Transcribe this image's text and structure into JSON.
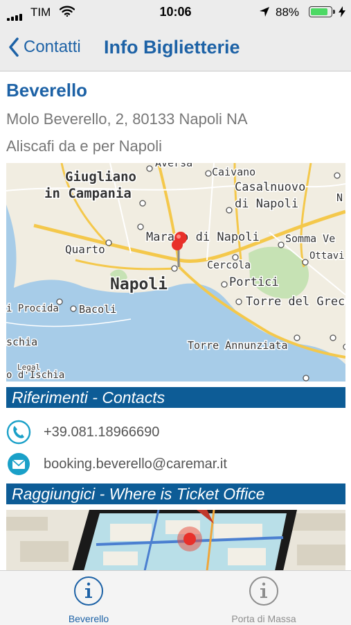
{
  "status_bar": {
    "carrier": "TIM",
    "time": "10:06",
    "battery_percent": "88%",
    "battery_level": 0.88,
    "icons": [
      "signal-bars-icon",
      "wifi-icon",
      "location-arrow-icon",
      "battery-icon",
      "charging-bolt-icon"
    ]
  },
  "nav": {
    "back_label": "Contatti",
    "title": "Info Biglietterie"
  },
  "office": {
    "name": "Beverello",
    "address": "Molo Beverello, 2, 80133 Napoli NA",
    "description": "Aliscafi da e per Napoli"
  },
  "map": {
    "legal": "Legal",
    "labels": {
      "aversa": "Aversa",
      "caivano": "Caivano",
      "giugliano": "Giugliano\nin Campania",
      "casalnuovo": "Casalnuovo\ndi Napoli",
      "n": "N",
      "marano": "Marano di Napoli",
      "somma": "Somma Ve",
      "quarto": "Quarto",
      "cercola": "Cercola",
      "ottavi": "Ottavi",
      "napoli": "Napoli",
      "portici": "Portici",
      "procida": "i Procida",
      "bacoli": "Bacoli",
      "torre_greco": "Torre del Greco",
      "ischia": "schia",
      "torre_annunziata": "Torre Annunziata",
      "ischia_port": "o d'Ischia"
    }
  },
  "contacts": {
    "header": "Riferimenti - Contacts",
    "phone": "+39.081.18966690",
    "email": "booking.beverello@caremar.it"
  },
  "directions": {
    "header": "Raggiungici - Where is Ticket Office"
  },
  "tabs": [
    {
      "label": "Beverello",
      "icon": "info-circle-icon",
      "active": true
    },
    {
      "label": "Porta di Massa",
      "icon": "info-circle-icon",
      "active": false
    }
  ],
  "colors": {
    "accent": "#1d62a6",
    "section_bar": "#0d5c96",
    "contact_icon": "#1aa0c8",
    "battery": "#4cd964"
  }
}
